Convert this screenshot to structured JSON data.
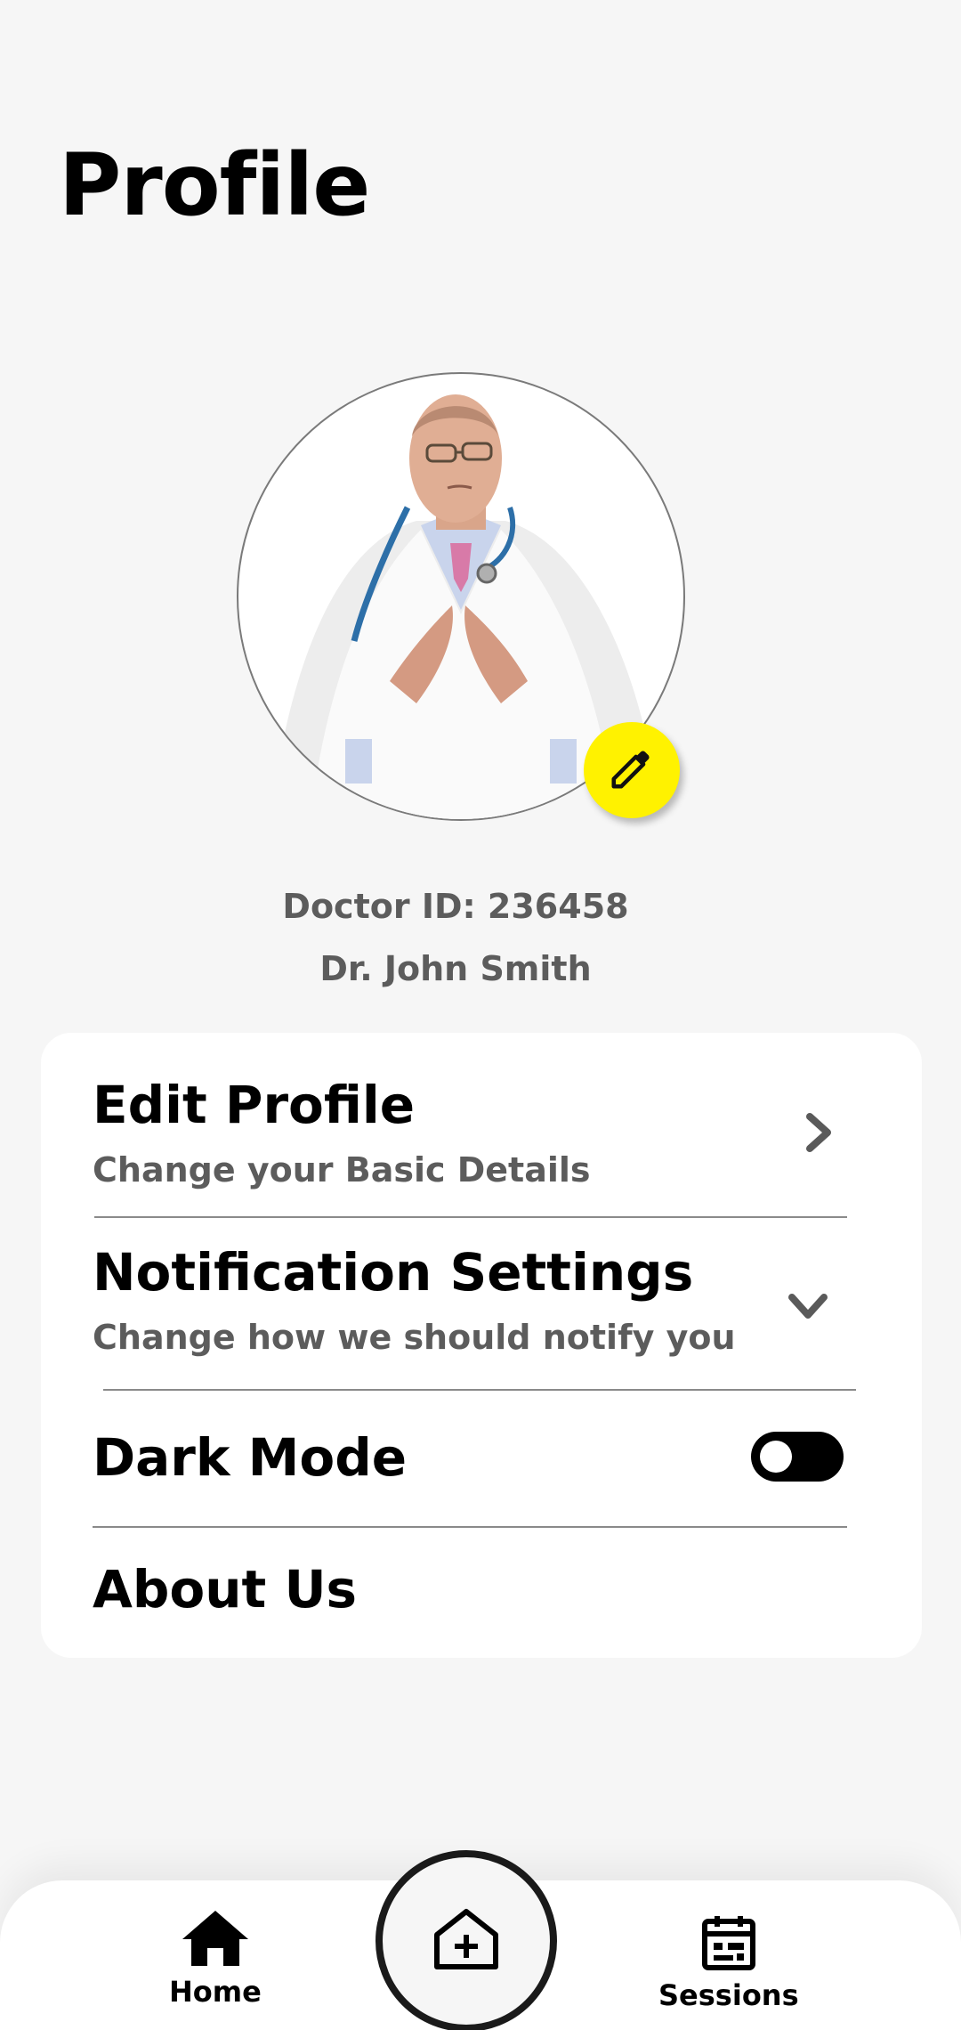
{
  "page": {
    "title": "Profile"
  },
  "profile": {
    "doctor_id": "Doctor ID: 236458",
    "name": "Dr. John Smith",
    "edit_photo_icon": "pencil-icon"
  },
  "settings": {
    "edit_profile": {
      "title": "Edit Profile",
      "subtitle": "Change your Basic Details",
      "icon": "chevron-right-icon"
    },
    "notifications": {
      "title": "Notification Settings",
      "subtitle": "Change how we should notify you",
      "icon": "chevron-down-icon"
    },
    "dark_mode": {
      "title": "Dark Mode",
      "enabled": false
    },
    "about": {
      "title": "About Us"
    }
  },
  "nav": {
    "home": {
      "label": "Home",
      "icon": "home-icon"
    },
    "add": {
      "icon": "hospital-plus-icon"
    },
    "sessions": {
      "label": "Sessions",
      "icon": "calendar-icon"
    }
  },
  "colors": {
    "background": "#f6f6f6",
    "accent": "#fff200",
    "card": "#ffffff",
    "muted_text": "#5c5c5c"
  }
}
